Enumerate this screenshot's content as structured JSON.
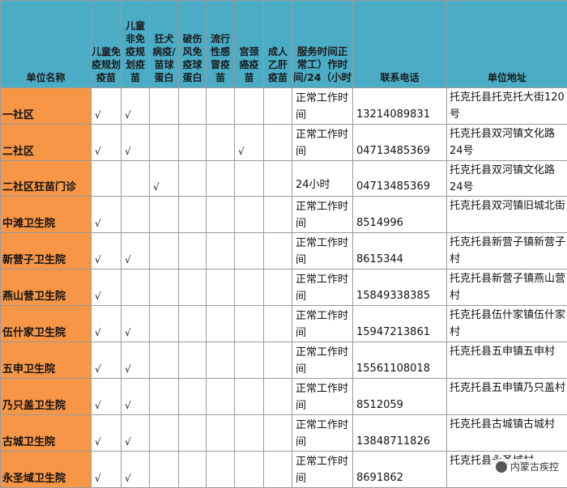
{
  "header": {
    "name": "单位名称",
    "c1": "儿童免疫规划疫苗",
    "c2": "儿童非免疫规划疫苗",
    "c3": "狂犬病疫/苗球蛋白",
    "c4": "破伤风免疫球蛋白",
    "c5": "流行性感冒疫苗",
    "c6": "宫颈癌疫苗",
    "c7": "成人乙肝疫苗",
    "hours": "服务时间正常工）作时间/24（小时",
    "phone": "联系电话",
    "addr": "单位地址"
  },
  "rows": [
    {
      "name": "一社区",
      "c1": "√",
      "c2": "√",
      "c3": "",
      "c4": "",
      "c5": "",
      "c6": "",
      "c7": "",
      "hours": "正常工作时间",
      "phone": "13214089831",
      "addr": "托克托县托克托大街120号"
    },
    {
      "name": "二社区",
      "c1": "√",
      "c2": "√",
      "c3": "",
      "c4": "",
      "c5": "",
      "c6": "√",
      "c7": "",
      "hours": "正常工作时间",
      "phone": "04713485369",
      "addr": "托克托县双河镇文化路24号"
    },
    {
      "name": "二社区狂苗门诊",
      "c1": "",
      "c2": "",
      "c3": "√",
      "c4": "",
      "c5": "",
      "c6": "",
      "c7": "",
      "hours": "24小时",
      "phone": "04713485369",
      "addr": "托克托县双河镇文化路24号"
    },
    {
      "name": "中滩卫生院",
      "c1": "√",
      "c2": "",
      "c3": "",
      "c4": "",
      "c5": "",
      "c6": "",
      "c7": "",
      "hours": "正常工作时间",
      "phone": "8514996",
      "addr": "托克托县双河镇旧城北街"
    },
    {
      "name": "新营子卫生院",
      "c1": "√",
      "c2": "√",
      "c3": "",
      "c4": "",
      "c5": "",
      "c6": "",
      "c7": "",
      "hours": "正常工作时间",
      "phone": "8615344",
      "addr": "托克托县新营子镇新营子村"
    },
    {
      "name": "燕山营卫生院",
      "c1": "√",
      "c2": "",
      "c3": "",
      "c4": "",
      "c5": "",
      "c6": "",
      "c7": "",
      "hours": "正常工作时间",
      "phone": "15849338385",
      "addr": "托克托县新营子镇燕山营村"
    },
    {
      "name": "伍什家卫生院",
      "c1": "√",
      "c2": "√",
      "c3": "",
      "c4": "",
      "c5": "",
      "c6": "",
      "c7": "",
      "hours": "正常工作时间",
      "phone": "15947213861",
      "addr": "托克托县伍什家镇伍什家村"
    },
    {
      "name": "五申卫生院",
      "c1": "√",
      "c2": "√",
      "c3": "",
      "c4": "",
      "c5": "",
      "c6": "",
      "c7": "",
      "hours": "正常工作时间",
      "phone": "15561108018",
      "addr": "托克托县五申镇五申村"
    },
    {
      "name": "乃只盖卫生院",
      "c1": "√",
      "c2": "√",
      "c3": "",
      "c4": "",
      "c5": "",
      "c6": "",
      "c7": "",
      "hours": "正常工作时间",
      "phone": "8512059",
      "addr": "托克托县五申镇乃只盖村"
    },
    {
      "name": "古城卫生院",
      "c1": "√",
      "c2": "√",
      "c3": "",
      "c4": "",
      "c5": "",
      "c6": "",
      "c7": "",
      "hours": "正常工作时间",
      "phone": "13848711826",
      "addr": "托克托县古城镇古城村"
    },
    {
      "name": "永圣域卫生院",
      "c1": "√",
      "c2": "√",
      "c3": "",
      "c4": "",
      "c5": "",
      "c6": "",
      "c7": "",
      "hours": "正常工作时间",
      "phone": "8691862",
      "addr": "托克托县永圣域村"
    }
  ],
  "watermark": "内蒙古疾控",
  "colors": {
    "header_bg": "#4bacc6",
    "name_bg": "#f79646"
  }
}
